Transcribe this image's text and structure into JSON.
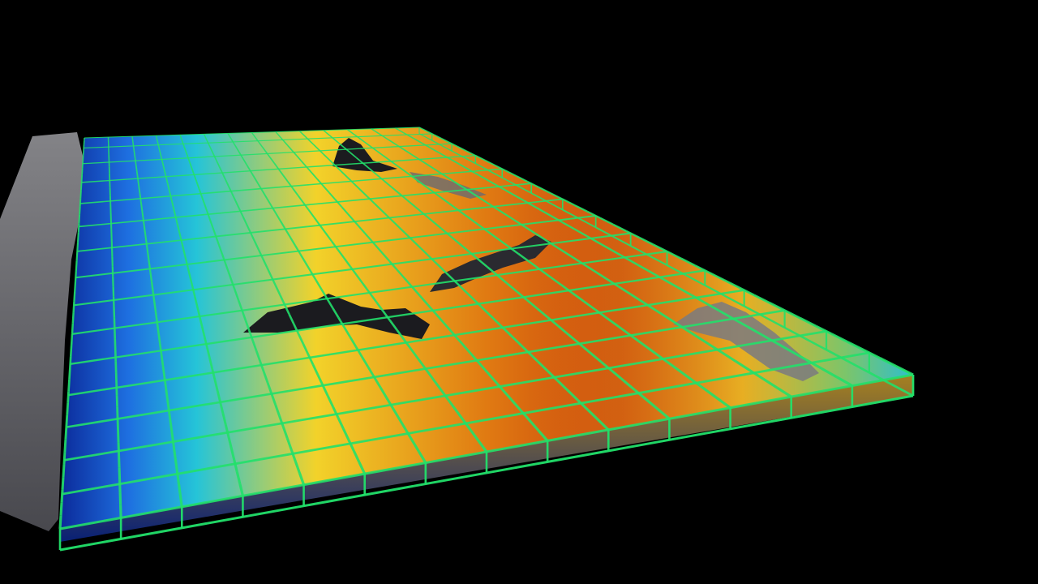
{
  "scene": {
    "background_color": "#000000",
    "grid_color": "#22e06a",
    "grid_columns": 14,
    "grid_rows": 15,
    "colormap": [
      "#0b2a9a",
      "#1e6fe0",
      "#25c4d8",
      "#f2d22a",
      "#e07a12",
      "#c8420c"
    ],
    "terrain_color": "#7a7a80",
    "peak_color": "#1b1b1f",
    "icons": [
      "ocean-volume",
      "terrain-ridge",
      "bounding-grid"
    ]
  }
}
